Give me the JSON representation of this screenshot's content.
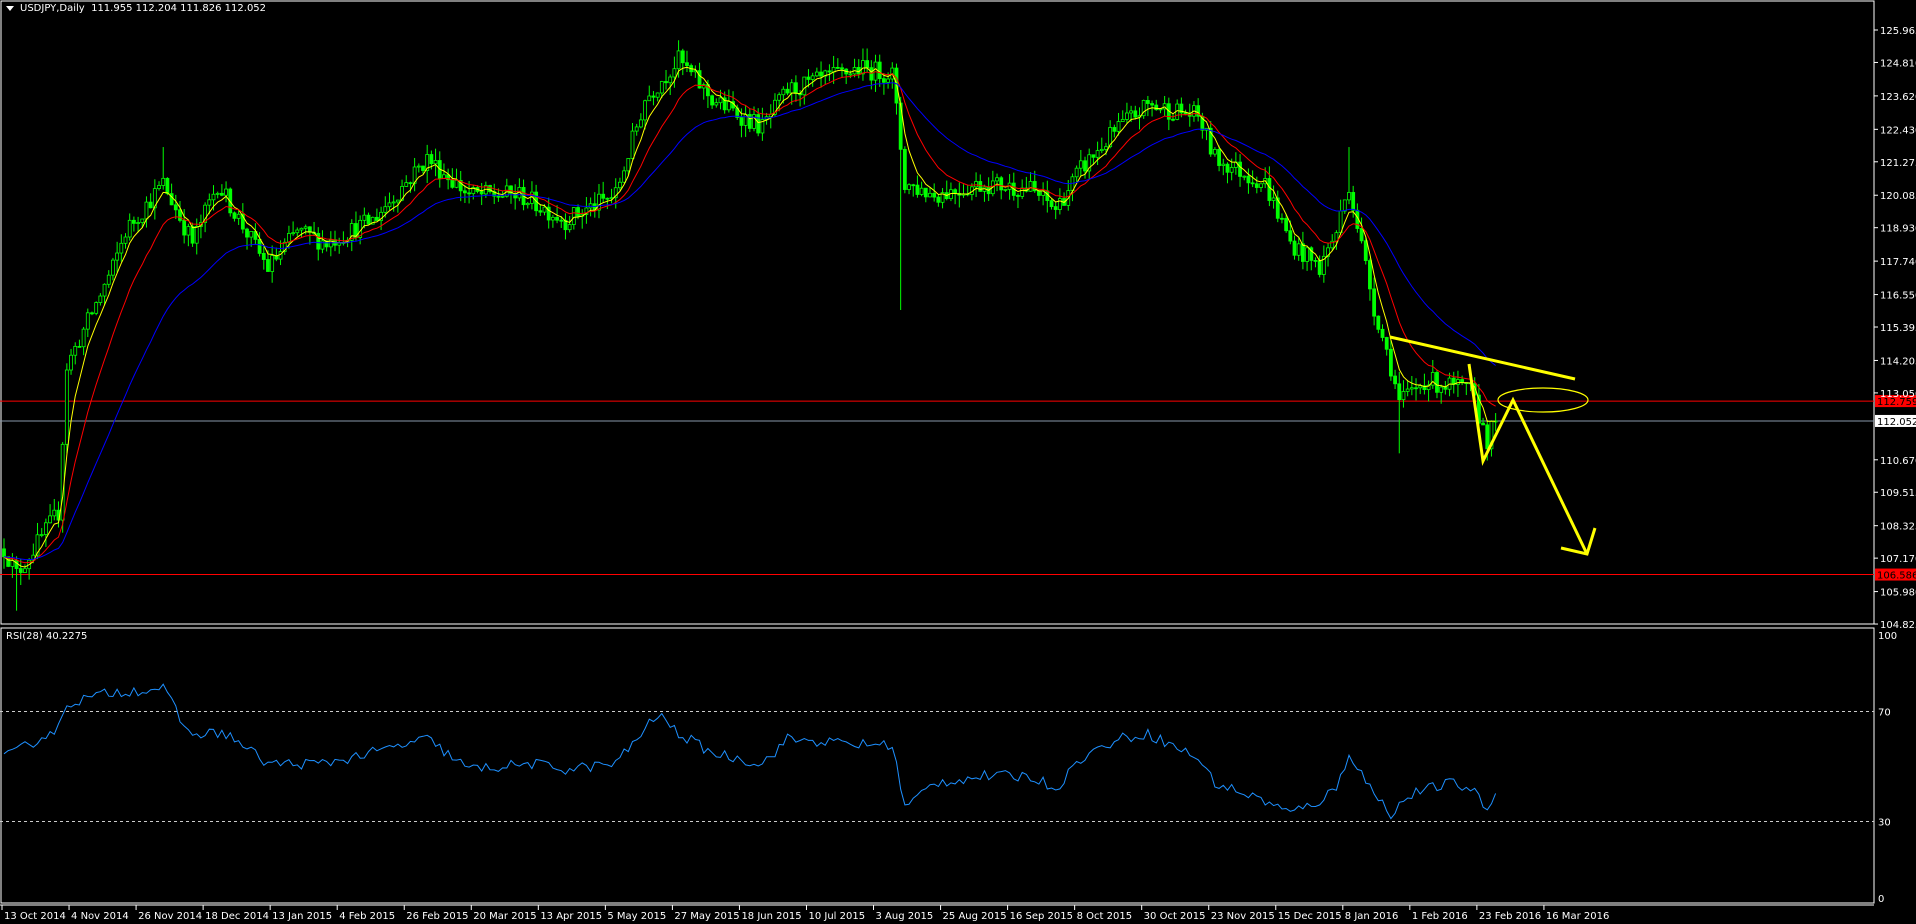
{
  "header": {
    "symbol": "USDJPY,Daily",
    "ohlc": "111.955 112.204 111.826 112.052"
  },
  "rsi_label": "RSI(28) 40.2275",
  "colors": {
    "background": "#000000",
    "candle": "#00ff00",
    "ma_fast": "#ffff00",
    "ma_mid": "#ff0000",
    "ma_slow": "#0000ff",
    "rsi": "#1e90ff",
    "annotation": "#ffff00",
    "level_red": "#ff0000",
    "bid_line": "#8899aa"
  },
  "chart_data": [
    {
      "type": "candlestick",
      "title": "USDJPY,Daily",
      "ylim": [
        104.825,
        125.965
      ],
      "price_ticks": [
        "125.965",
        "124.810",
        "123.620",
        "122.430",
        "121.275",
        "120.085",
        "118.930",
        "117.740",
        "116.550",
        "115.395",
        "114.205",
        "113.050",
        "110.670",
        "109.515",
        "108.325",
        "107.170",
        "105.980",
        "104.825"
      ],
      "date_ticks": [
        "13 Oct 2014",
        "4 Nov 2014",
        "26 Nov 2014",
        "18 Dec 2014",
        "13 Jan 2015",
        "4 Feb 2015",
        "26 Feb 2015",
        "20 Mar 2015",
        "13 Apr 2015",
        "5 May 2015",
        "27 May 2015",
        "18 Jun 2015",
        "10 Jul 2015",
        "3 Aug 2015",
        "25 Aug 2015",
        "16 Sep 2015",
        "8 Oct 2015",
        "30 Oct 2015",
        "23 Nov 2015",
        "15 Dec 2015",
        "8 Jan 2016",
        "1 Feb 2016",
        "23 Feb 2016",
        "16 Mar 2016"
      ],
      "bars_total": 357,
      "bars_per_date_tick": 16,
      "close_keypoints": [
        [
          0,
          107.5
        ],
        [
          3,
          106.6
        ],
        [
          13,
          108.8
        ],
        [
          15,
          114.0
        ],
        [
          26,
          117.5
        ],
        [
          29,
          118.8
        ],
        [
          38,
          120.5
        ],
        [
          45,
          118.4
        ],
        [
          51,
          120.5
        ],
        [
          63,
          117.5
        ],
        [
          70,
          118.8
        ],
        [
          77,
          118.4
        ],
        [
          88,
          119.2
        ],
        [
          101,
          121.4
        ],
        [
          111,
          120.1
        ],
        [
          123,
          120.1
        ],
        [
          134,
          119.2
        ],
        [
          146,
          120.1
        ],
        [
          153,
          123.5
        ],
        [
          161,
          124.9
        ],
        [
          169,
          123.5
        ],
        [
          181,
          122.5
        ],
        [
          187,
          123.8
        ],
        [
          204,
          124.6
        ],
        [
          212,
          124.4
        ],
        [
          215,
          120.5
        ],
        [
          222,
          120.1
        ],
        [
          234,
          120.5
        ],
        [
          245,
          120.3
        ],
        [
          251,
          119.6
        ],
        [
          257,
          121.0
        ],
        [
          266,
          122.5
        ],
        [
          273,
          123.3
        ],
        [
          285,
          122.9
        ],
        [
          289,
          121.4
        ],
        [
          301,
          120.5
        ],
        [
          307,
          118.4
        ],
        [
          314,
          117.5
        ],
        [
          318,
          118.8
        ],
        [
          321,
          120.5
        ],
        [
          327,
          116.1
        ],
        [
          331,
          114.0
        ],
        [
          333,
          112.7
        ],
        [
          339,
          113.5
        ],
        [
          345,
          113.3
        ],
        [
          350,
          113.1
        ],
        [
          354,
          111.4
        ],
        [
          356,
          112.05
        ]
      ],
      "extreme_wicks": [
        [
          3,
          105.3
        ],
        [
          38,
          121.8
        ],
        [
          161,
          125.6
        ],
        [
          214,
          116.0
        ],
        [
          321,
          121.8
        ],
        [
          333,
          110.9
        ]
      ],
      "levels": [
        {
          "label": "112.759",
          "value": 112.759,
          "kind": "resistance"
        },
        {
          "label": "106.586",
          "value": 106.586,
          "kind": "target"
        },
        {
          "label": "112.052",
          "value": 112.052,
          "kind": "bid"
        }
      ],
      "moving_averages": [
        {
          "period": 5,
          "color": "yellow"
        },
        {
          "period": 13,
          "color": "red"
        },
        {
          "period": 34,
          "color": "blue"
        }
      ]
    },
    {
      "type": "line",
      "title": "RSI(28) 40.2275",
      "ylim": [
        0,
        100
      ],
      "levels": [
        70,
        30
      ],
      "level_labels": [
        "100",
        "70",
        "30",
        "0"
      ],
      "keypoints": [
        [
          0,
          53
        ],
        [
          13,
          64
        ],
        [
          15,
          73
        ],
        [
          26,
          77
        ],
        [
          38,
          78.5
        ],
        [
          44,
          62
        ],
        [
          53,
          62
        ],
        [
          63,
          51
        ],
        [
          76,
          51
        ],
        [
          88,
          55
        ],
        [
          101,
          60
        ],
        [
          111,
          49
        ],
        [
          126,
          51
        ],
        [
          134,
          49
        ],
        [
          146,
          51
        ],
        [
          156,
          69
        ],
        [
          161,
          62
        ],
        [
          169,
          55
        ],
        [
          181,
          51
        ],
        [
          187,
          60
        ],
        [
          204,
          58
        ],
        [
          212,
          58
        ],
        [
          215,
          35
        ],
        [
          222,
          44
        ],
        [
          234,
          46.5
        ],
        [
          245,
          46.5
        ],
        [
          251,
          42
        ],
        [
          257,
          53
        ],
        [
          266,
          60
        ],
        [
          273,
          62
        ],
        [
          285,
          53
        ],
        [
          289,
          44
        ],
        [
          301,
          37.5
        ],
        [
          307,
          33
        ],
        [
          314,
          37.5
        ],
        [
          318,
          42
        ],
        [
          321,
          55
        ],
        [
          327,
          40
        ],
        [
          331,
          33
        ],
        [
          336,
          40
        ],
        [
          345,
          44
        ],
        [
          350,
          42
        ],
        [
          354,
          35
        ],
        [
          357,
          40.2
        ]
      ]
    }
  ]
}
